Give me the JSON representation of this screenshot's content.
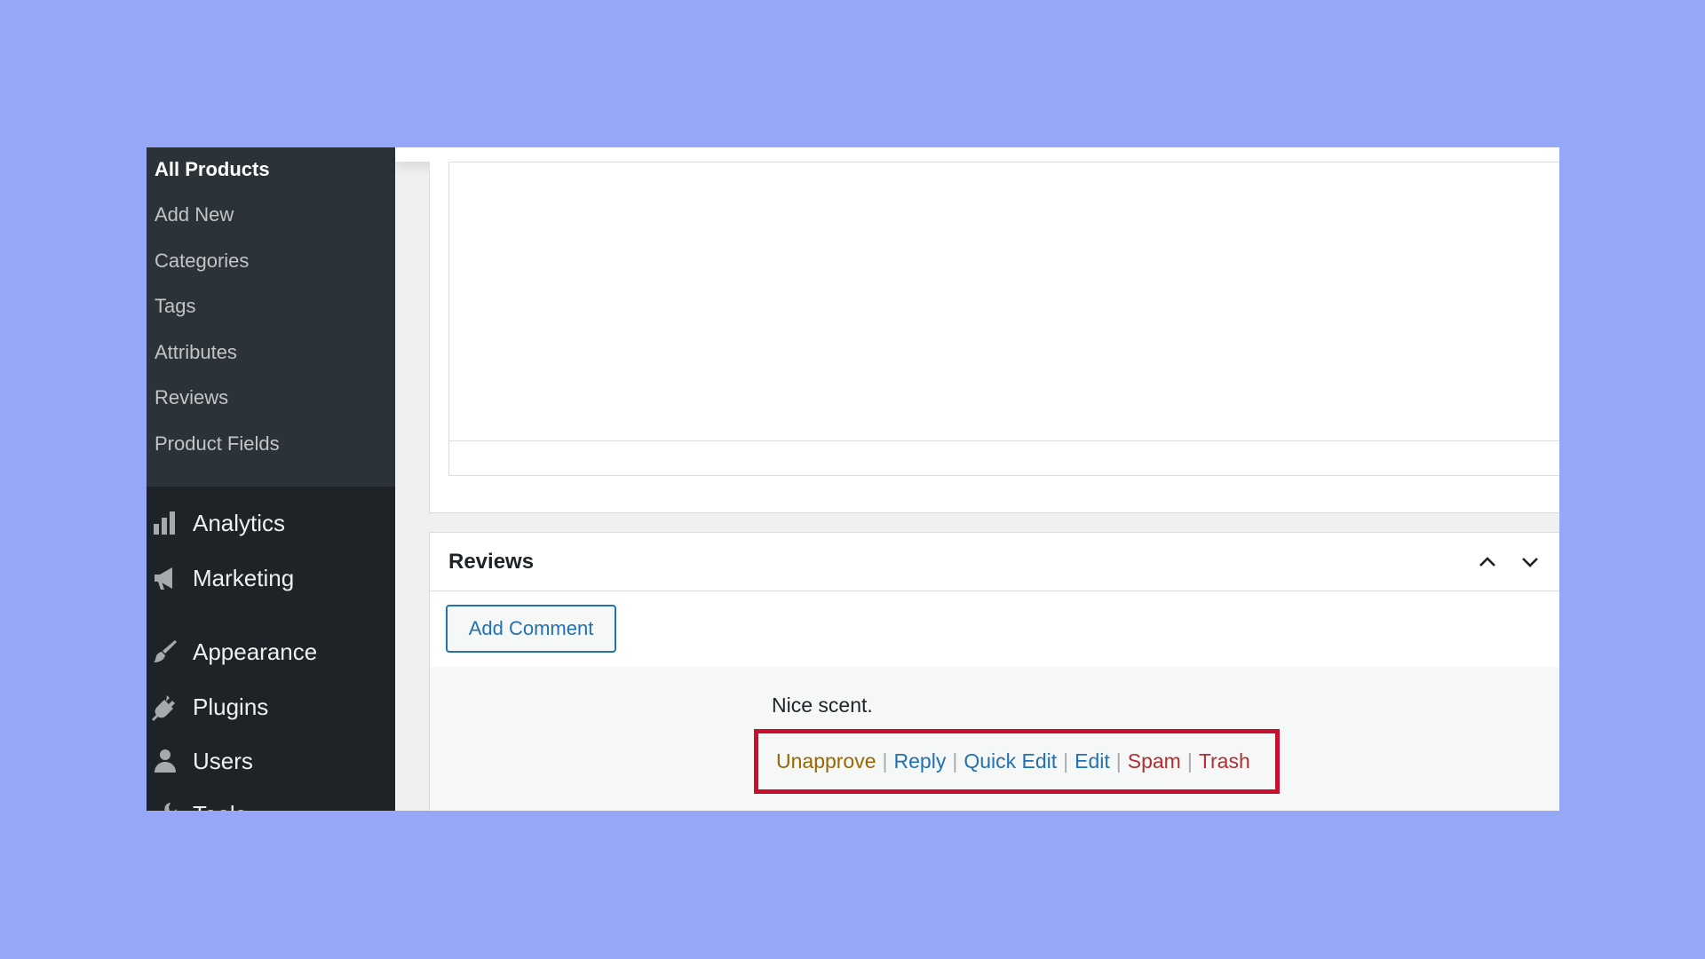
{
  "sidebar": {
    "submenu": [
      {
        "label": "All Products",
        "active": true
      },
      {
        "label": "Add New"
      },
      {
        "label": "Categories"
      },
      {
        "label": "Tags"
      },
      {
        "label": "Attributes"
      },
      {
        "label": "Reviews"
      },
      {
        "label": "Product Fields"
      }
    ],
    "menu": [
      {
        "label": "Analytics",
        "icon": "bar-chart-icon"
      },
      {
        "label": "Marketing",
        "icon": "megaphone-icon"
      },
      {
        "label": "Appearance",
        "icon": "paintbrush-icon"
      },
      {
        "label": "Plugins",
        "icon": "plug-icon"
      },
      {
        "label": "Users",
        "icon": "user-icon"
      },
      {
        "label": "Tools",
        "icon": "wrench-icon"
      }
    ]
  },
  "reviews": {
    "title": "Reviews",
    "add_comment_label": "Add Comment",
    "comment": {
      "text": "Nice scent.",
      "actions": {
        "unapprove": "Unapprove",
        "reply": "Reply",
        "quick_edit": "Quick Edit",
        "edit": "Edit",
        "spam": "Spam",
        "trash": "Trash",
        "separator": "|"
      }
    }
  },
  "colors": {
    "page_background": "#96a7f8",
    "sidebar": "#1d2327",
    "submenu": "#2c3338",
    "link": "#2271b1",
    "unapprove": "#996800",
    "danger": "#b32d2e",
    "highlight_box": "#c8102e"
  }
}
